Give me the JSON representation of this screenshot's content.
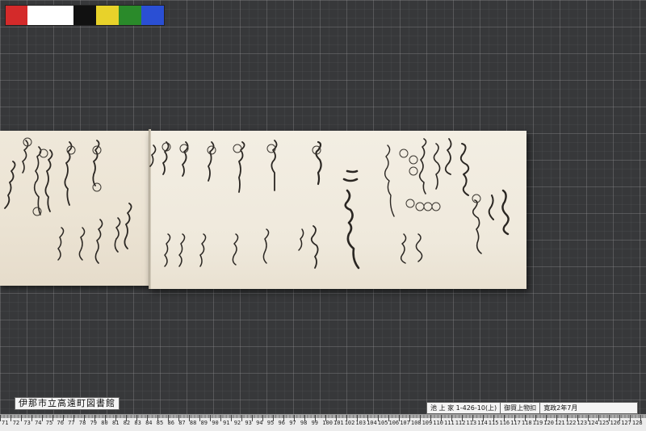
{
  "color_chart": {
    "colors": [
      "#d42a2a",
      "#ffffff",
      "#111111",
      "#e8d22a",
      "#2a8a2a",
      "#2a4fd4"
    ]
  },
  "labels": {
    "library": "伊那市立高遠町図書館",
    "catalog_id": "池 上 家 1-426-10(上)",
    "document_title": "御買上物扣",
    "date": "寛政2年7月"
  },
  "ruler": {
    "numbers": [
      "71",
      "72",
      "73",
      "74",
      "75",
      "76",
      "77",
      "78",
      "79",
      "80",
      "81",
      "82",
      "83",
      "84",
      "85",
      "86",
      "87",
      "88",
      "89",
      "90",
      "91",
      "92",
      "93",
      "94",
      "95",
      "96",
      "97",
      "98",
      "99",
      "100",
      "101",
      "102",
      "103",
      "104",
      "105",
      "106",
      "107",
      "108",
      "109",
      "110",
      "111",
      "112",
      "113",
      "114",
      "115",
      "116",
      "117",
      "118",
      "119",
      "120",
      "121",
      "122",
      "123",
      "124",
      "125",
      "126",
      "127",
      "128"
    ]
  }
}
